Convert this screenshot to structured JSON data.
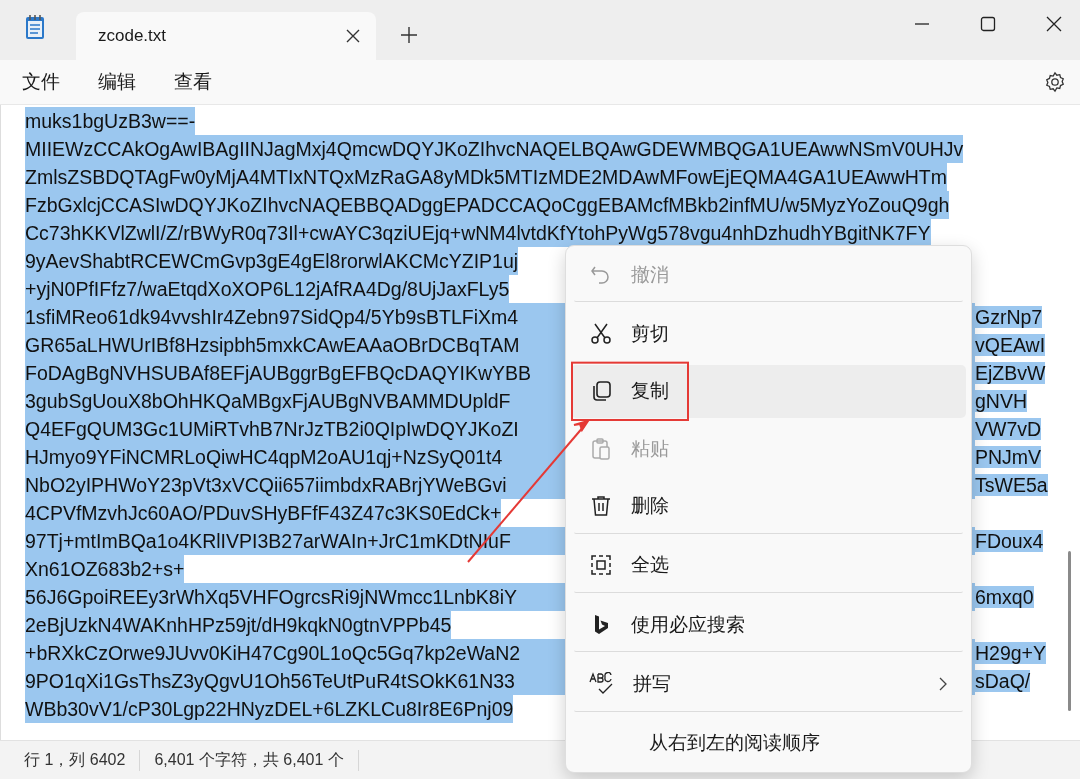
{
  "window": {
    "tab_title": "zcode.txt"
  },
  "menu_bar": [
    {
      "label": "文件"
    },
    {
      "label": "编辑"
    },
    {
      "label": "查看"
    }
  ],
  "editor": {
    "selected": true,
    "lines": [
      {
        "text": "muks1bgUzB3w==-"
      },
      {
        "text": "MIIEWzCCAkOgAwIBAgIINJagMxj4QmcwDQYJKoZIhvcNAQELBQAwGDEWMBQGA1UEAwwNSmV0UHJv"
      },
      {
        "text": "ZmlsZSBDQTAgFw0yMjA4MTIxNTQxMzRaGA8yMDk5MTIzMDE2MDAwMFowEjEQMA4GA1UEAwwHTm"
      },
      {
        "text": "FzbGxlcjCCASIwDQYJKoZIhvcNAQEBBQADggEPADCCAQoCggEBAMcfMBkb2infMU/w5MyzYoZouQ9gh"
      },
      {
        "text": "Cc73hKKVlZwlI/Z/rBWyR0q73Il+cwAYC3qziUEjq+wNM4lvtdKfYtohPyWg578vgu4nhDzhudhYBgitNK7FY"
      },
      {
        "text": "9yAevShabtRCEWCmGvp3gE4gEl8rorwlAKCMcYZIP1uj"
      },
      {
        "text": "+yjN0PfIFfz7/waEtqdXoXOP6L12jAfRA4Dg/8UjJaxFLy5"
      },
      {
        "text": "1sfiMReo61dk94vvshIr4Zebn97SidQp4/5Yb9sBTLFiXm4",
        "tail": "GzrNp7"
      },
      {
        "text": "GR65aLHWUrIBf8Hzsipbh5mxkCAwEAAaOBrDCBqTAM",
        "tail": "vQEAwI"
      },
      {
        "text": "FoDAgBgNVHSUBAf8EFjAUBggrBgEFBQcDAQYIKwYBB",
        "tail": "EjZBvW"
      },
      {
        "text": "3gubSgUouX8bOhHKQaMBgxFjAUBgNVBAMMDUpldF",
        "tail": "gNVH"
      },
      {
        "text": "Q4EFgQUM3Gc1UMiRTvhB7NrJzTB2i0QIpIwDQYJKoZI",
        "tail": "VW7vD"
      },
      {
        "text": "HJmyo9YFiNCMRLoQiwHC4qpM2oAU1qj+NzSyQ01t4",
        "tail": "PNJmV"
      },
      {
        "text": "NbO2yIPHWoY23pVt3xVCQii657iimbdxRABrjYWeBGvi",
        "tail": "TsWE5a"
      },
      {
        "text": "4CPVfMzvhJc60AO/PDuvSHyBFfF43Z47c3KS0EdCk+"
      },
      {
        "text": "97Tj+mtImBQa1o4KRlIVPI3B27arWAIn+JrC1mKDtNIuF",
        "tail": "FDoux4"
      },
      {
        "text": "Xn61OZ683b2+s+"
      },
      {
        "text": "56J6GpoiREEy3rWhXq5VHFOgrcsRi9jNWmcc1LnbK8iY",
        "tail": "6mxq0"
      },
      {
        "text": "2eBjUzkN4WAKnhHPz59jt/dH9kqkN0gtnVPPb45"
      },
      {
        "text": "+bRXkCzOrwe9JUvv0KiH47Cg90L1oQc5Gq7kp2eWaN2",
        "tail": "H29g+Y"
      },
      {
        "text": "9PO1qXi1GsThsZ3yQgvU1Oh56TeUtPuR4tSOkK61N33",
        "tail": "sDaQ/"
      },
      {
        "text": "WBb30vV1/cP30Lgp22HNyzDEL+6LZKLCu8Ir8E6Pnj09"
      }
    ]
  },
  "status_bar": [
    {
      "text": "行 1，列 6402"
    },
    {
      "text": "6,401 个字符，共 6,401 个"
    }
  ],
  "context_menu": {
    "items": [
      {
        "kind": "undo",
        "label": "撤消",
        "disabled": true,
        "hovered": false,
        "annotated": false,
        "separator_after": true,
        "submenu": false
      },
      {
        "kind": "cut",
        "label": "剪切",
        "disabled": false,
        "hovered": false,
        "annotated": false,
        "separator_after": false,
        "submenu": false
      },
      {
        "kind": "copy",
        "label": "复制",
        "disabled": false,
        "hovered": true,
        "annotated": true,
        "separator_after": false,
        "submenu": false
      },
      {
        "kind": "paste",
        "label": "粘贴",
        "disabled": true,
        "hovered": false,
        "annotated": false,
        "separator_after": false,
        "submenu": false
      },
      {
        "kind": "delete",
        "label": "删除",
        "disabled": false,
        "hovered": false,
        "annotated": false,
        "separator_after": true,
        "submenu": false
      },
      {
        "kind": "select_all",
        "label": "全选",
        "disabled": false,
        "hovered": false,
        "annotated": false,
        "separator_after": true,
        "submenu": false
      },
      {
        "kind": "search",
        "label": "使用必应搜索",
        "disabled": false,
        "hovered": false,
        "annotated": false,
        "separator_after": true,
        "submenu": false
      },
      {
        "kind": "spelling",
        "label": "拼写",
        "disabled": false,
        "hovered": false,
        "annotated": false,
        "separator_after": true,
        "submenu": true
      },
      {
        "kind": "rtl",
        "label": "从右到左的阅读顺序",
        "disabled": false,
        "hovered": false,
        "annotated": false,
        "separator_after": false,
        "submenu": false
      }
    ]
  }
}
